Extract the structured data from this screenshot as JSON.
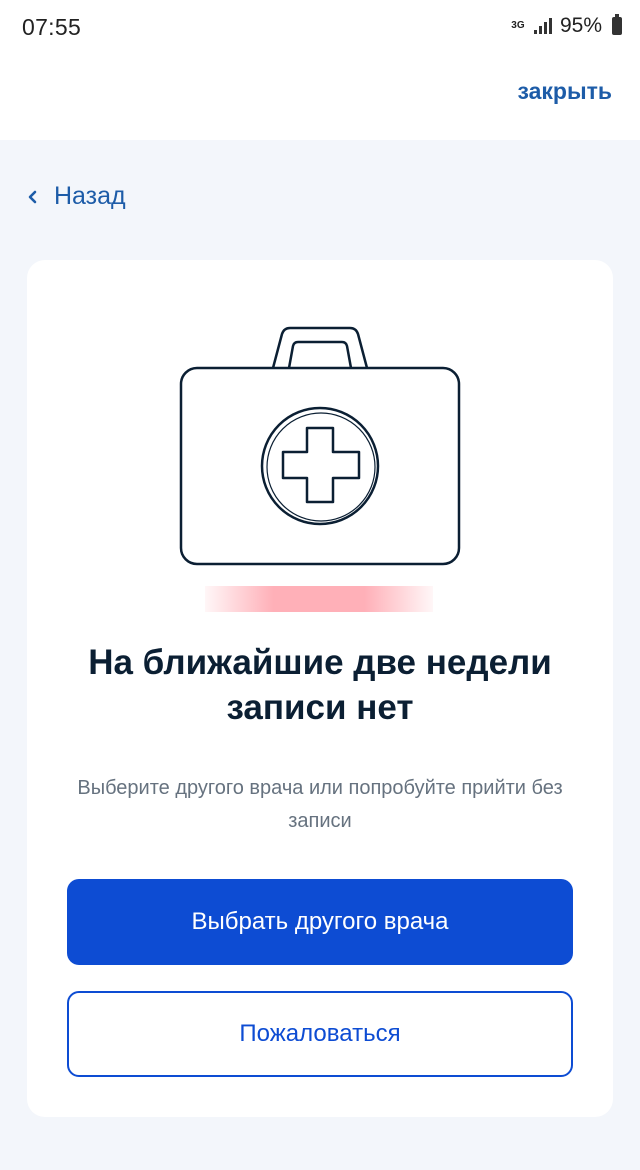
{
  "status_bar": {
    "time": "07:55",
    "network": "3G",
    "battery": "95%"
  },
  "header": {
    "close_label": "закрыть"
  },
  "nav": {
    "back_label": "Назад"
  },
  "card": {
    "illustration": "medical-kit-icon",
    "title": "На ближайшие две недели записи нет",
    "subtitle": "Выберите другого врача или попробуйте прийти без записи",
    "primary_button": "Выбрать другого врача",
    "secondary_button": "Пожаловаться"
  },
  "colors": {
    "accent": "#0d4cd3",
    "link": "#1d5ca8",
    "title": "#0b1f33",
    "subtitle": "#66727f",
    "background": "#f3f6fb"
  }
}
